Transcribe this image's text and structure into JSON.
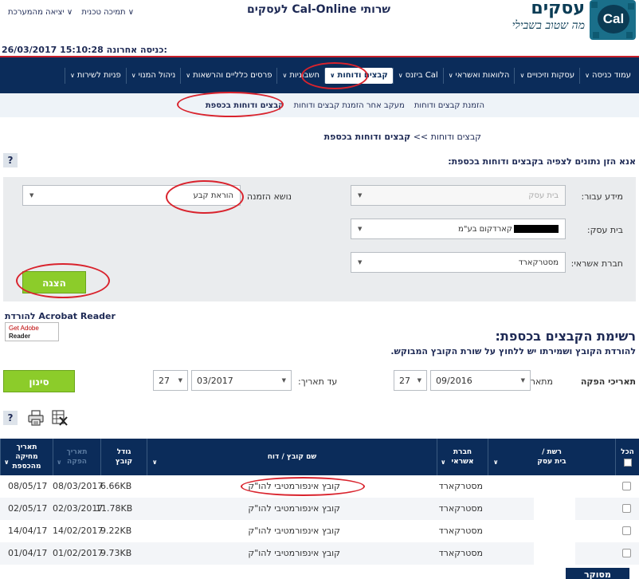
{
  "header": {
    "logo_text": "Cal",
    "logo_word": "עסקים",
    "logo_slogan": "מה שטוב בשבילי",
    "site_title": "שרותי Cal-Online לעסקים",
    "util_links": [
      "∨ תמיכה טכנית",
      "∨ יציאה מהמערכת"
    ],
    "last_login_label": "כניסה אחרונה:",
    "last_login_value": "26/03/2017 15:10:28"
  },
  "nav": {
    "items": [
      {
        "label": "עמוד כניסה",
        "active": false
      },
      {
        "label": "עסקות וזיכויים",
        "active": false
      },
      {
        "label": "הלוואות ואשראי",
        "active": false
      },
      {
        "label": "Cal ביזנס",
        "active": false
      },
      {
        "label": "קבצים ודוחות",
        "active": true
      },
      {
        "label": "חשבוניות",
        "active": false
      },
      {
        "label": "פרסים כלליים והרשאות",
        "active": false
      },
      {
        "label": "ניהול המנוי",
        "active": false
      },
      {
        "label": "פניות לשירות",
        "active": false
      }
    ],
    "sub_items": [
      {
        "label": "הזמנת קבצים ודוחות",
        "active": false
      },
      {
        "label": "מעקב אחר הזמנת קבצים ודוחות",
        "active": false
      },
      {
        "label": "קבצים ודוחות בכספת",
        "active": true
      }
    ]
  },
  "breadcrumb": {
    "parent": "קבצים ודוחות >>",
    "current": "קבצים ודוחות בכספת"
  },
  "instructions": "אנא הזן נתונים לצפיה בקבצים ודוחות בכספת:",
  "help_label": "?",
  "form": {
    "info_for_label": "מידע עבור:",
    "info_for_value": "בית עסק",
    "business_label": "בית עסק:",
    "business_value": "קארדקום בע\"מ",
    "card_company_label": "חברת אשראי:",
    "card_company_value": "מסטרקארד",
    "order_subject_label": "נושא הזמנה",
    "order_subject_value": "הוראת קבע",
    "show_button": "הצגה"
  },
  "acrobat": {
    "download_text": "להורדת Acrobat Reader",
    "badge_line1": "Get Adobe",
    "badge_line2": "Reader"
  },
  "file_list": {
    "title": "רשימת הקבצים בכספת:",
    "hint": "להורדת הקובץ ושמירתו יש ללחוץ על שורת הקובץ המבוקש."
  },
  "filter": {
    "production_dates_label": "תאריכי הפקה",
    "from_label": "מתאריך:",
    "from_month": "09/2016",
    "from_day": "27",
    "to_label": "עד תאריך:",
    "to_month": "03/2017",
    "to_day": "27",
    "filter_button": "סינון"
  },
  "table": {
    "headers": {
      "all": "הכל",
      "network": "רשת /\nבית עסק",
      "card_company": "חברת\nאשראי",
      "file_name": "שם קובץ / דוח",
      "size": "גודל\nקובץ",
      "production_date": "תאריך\nהפקה",
      "vault_date": "תאריך מחיקה\nמהכספת"
    },
    "rows": [
      {
        "card_company": "מסטרקארד",
        "file_name": "קובץ אינפורמטיבי להו\"ק",
        "size": "6.66KB",
        "production_date": "08/03/2017",
        "vault_date": "08/05/17"
      },
      {
        "card_company": "מסטרקארד",
        "file_name": "קובץ אינפורמטיבי להו\"ק",
        "size": "11.78KB",
        "production_date": "02/03/2017",
        "vault_date": "02/05/17"
      },
      {
        "card_company": "מסטרקארד",
        "file_name": "קובץ אינפורמטיבי להו\"ק",
        "size": "9.22KB",
        "production_date": "14/02/2017",
        "vault_date": "14/04/17"
      },
      {
        "card_company": "מסטרקארד",
        "file_name": "קובץ אינפורמטיבי להו\"ק",
        "size": "9.73KB",
        "production_date": "01/02/2017",
        "vault_date": "01/04/17"
      }
    ]
  },
  "bottom_button": "מסוקר",
  "colors": {
    "nav_bg": "#0b2c5a",
    "accent_green": "#8ccc2a",
    "highlight_red": "#d9232d",
    "brand_red": "#c61f29"
  }
}
